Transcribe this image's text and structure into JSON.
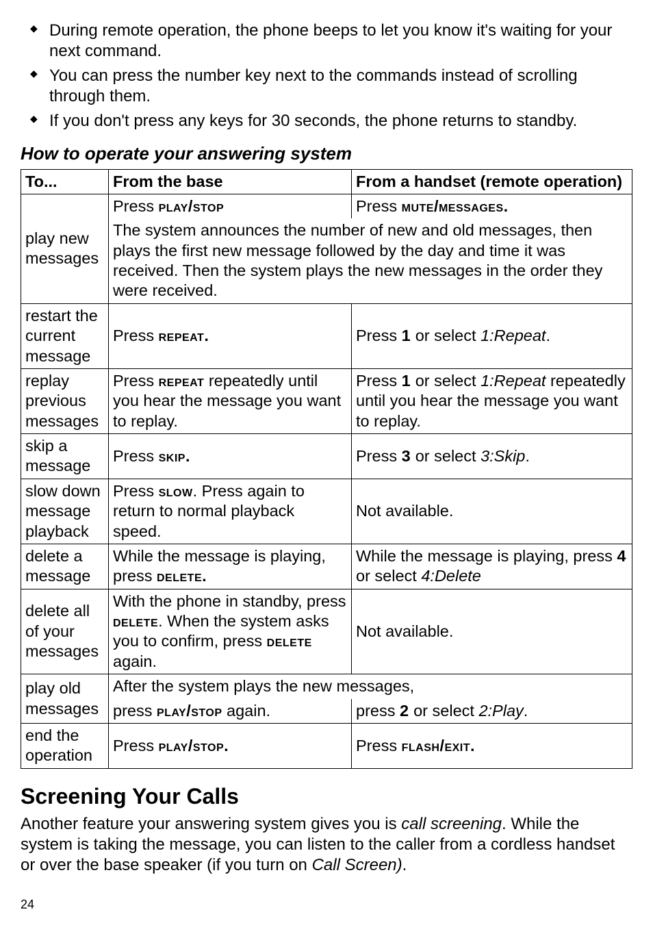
{
  "bullets": [
    "During remote operation, the phone beeps to let you know it's waiting for your next command.",
    "You can press the number key next to the commands instead of scrolling through them.",
    "If you don't press any keys for 30 seconds, the phone returns to standby."
  ],
  "subheading": "How to operate your answering system",
  "table": {
    "headers": {
      "to": "To...",
      "base": "From the base",
      "handset": "From a handset (remote operation)"
    },
    "rows": {
      "play_new": {
        "to": "play new messages",
        "base_prefix": "Press ",
        "base_cmd": "play/stop",
        "handset_prefix": "Press ",
        "handset_cmd": "mute/messages.",
        "body": "The system announces the number of new and old messages, then plays the first new message followed by the day and time it was received. Then the system plays the new messages in the order they were received."
      },
      "restart": {
        "to": "restart the current message",
        "base_prefix": "Press ",
        "base_cmd": "repeat.",
        "handset_p1": "Press ",
        "handset_n1": "1",
        "handset_p2": " or select ",
        "handset_opt": "1:Repeat",
        "handset_p3": "."
      },
      "replay": {
        "to": "replay previous messages",
        "base_p1": "Press ",
        "base_cmd": "repeat",
        "base_p2": " repeatedly until you hear the message you want to replay.",
        "handset_p1": "Press ",
        "handset_n1": "1",
        "handset_p2": " or select ",
        "handset_opt": "1:Repeat",
        "handset_p3": " repeatedly until you hear the message you want to replay."
      },
      "skip": {
        "to": "skip a message",
        "base_prefix": "Press ",
        "base_cmd": "skip.",
        "handset_p1": "Press ",
        "handset_n1": "3",
        "handset_p2": " or select ",
        "handset_opt": "3:Skip",
        "handset_p3": "."
      },
      "slow": {
        "to": "slow down message playback",
        "base_p1": "Press ",
        "base_cmd": "slow",
        "base_p2": ". Press again to return to normal playback speed.",
        "handset": "Not available."
      },
      "delete": {
        "to": "delete a message",
        "base_p1": "While the message is playing, press ",
        "base_cmd": "delete.",
        "handset_p1": "While the message is playing, press ",
        "handset_n1": "4",
        "handset_p2": " or select ",
        "handset_opt": "4:Delete"
      },
      "delete_all": {
        "to": "delete all of your messages",
        "base_p1": "With the phone in standby, press ",
        "base_cmd1": "delete",
        "base_p2": ". When the system asks you to confirm, press ",
        "base_cmd2": "delete",
        "base_p3": " again.",
        "handset": "Not available."
      },
      "play_old": {
        "to": "play old messages",
        "shared": "After the system plays the new messages,",
        "base_p1": "press ",
        "base_cmd": "play/stop",
        "base_p2": " again.",
        "handset_p1": "press ",
        "handset_n1": "2",
        "handset_p2": " or select ",
        "handset_opt": "2:Play",
        "handset_p3": "."
      },
      "end": {
        "to": "end the operation",
        "base_prefix": "Press ",
        "base_cmd": "play/stop.",
        "handset_prefix": "Press ",
        "handset_cmd": "flash/exit."
      }
    }
  },
  "heading2": "Screening Your Calls",
  "screening_para_p1": "Another feature your answering system gives you is ",
  "screening_para_it1": "call screening",
  "screening_para_p2": ". While the system is taking the message, you can listen to the caller from a cordless handset or over the base speaker (if you turn on ",
  "screening_para_it2": "Call Screen)",
  "screening_para_p3": ".",
  "page_number": "24"
}
